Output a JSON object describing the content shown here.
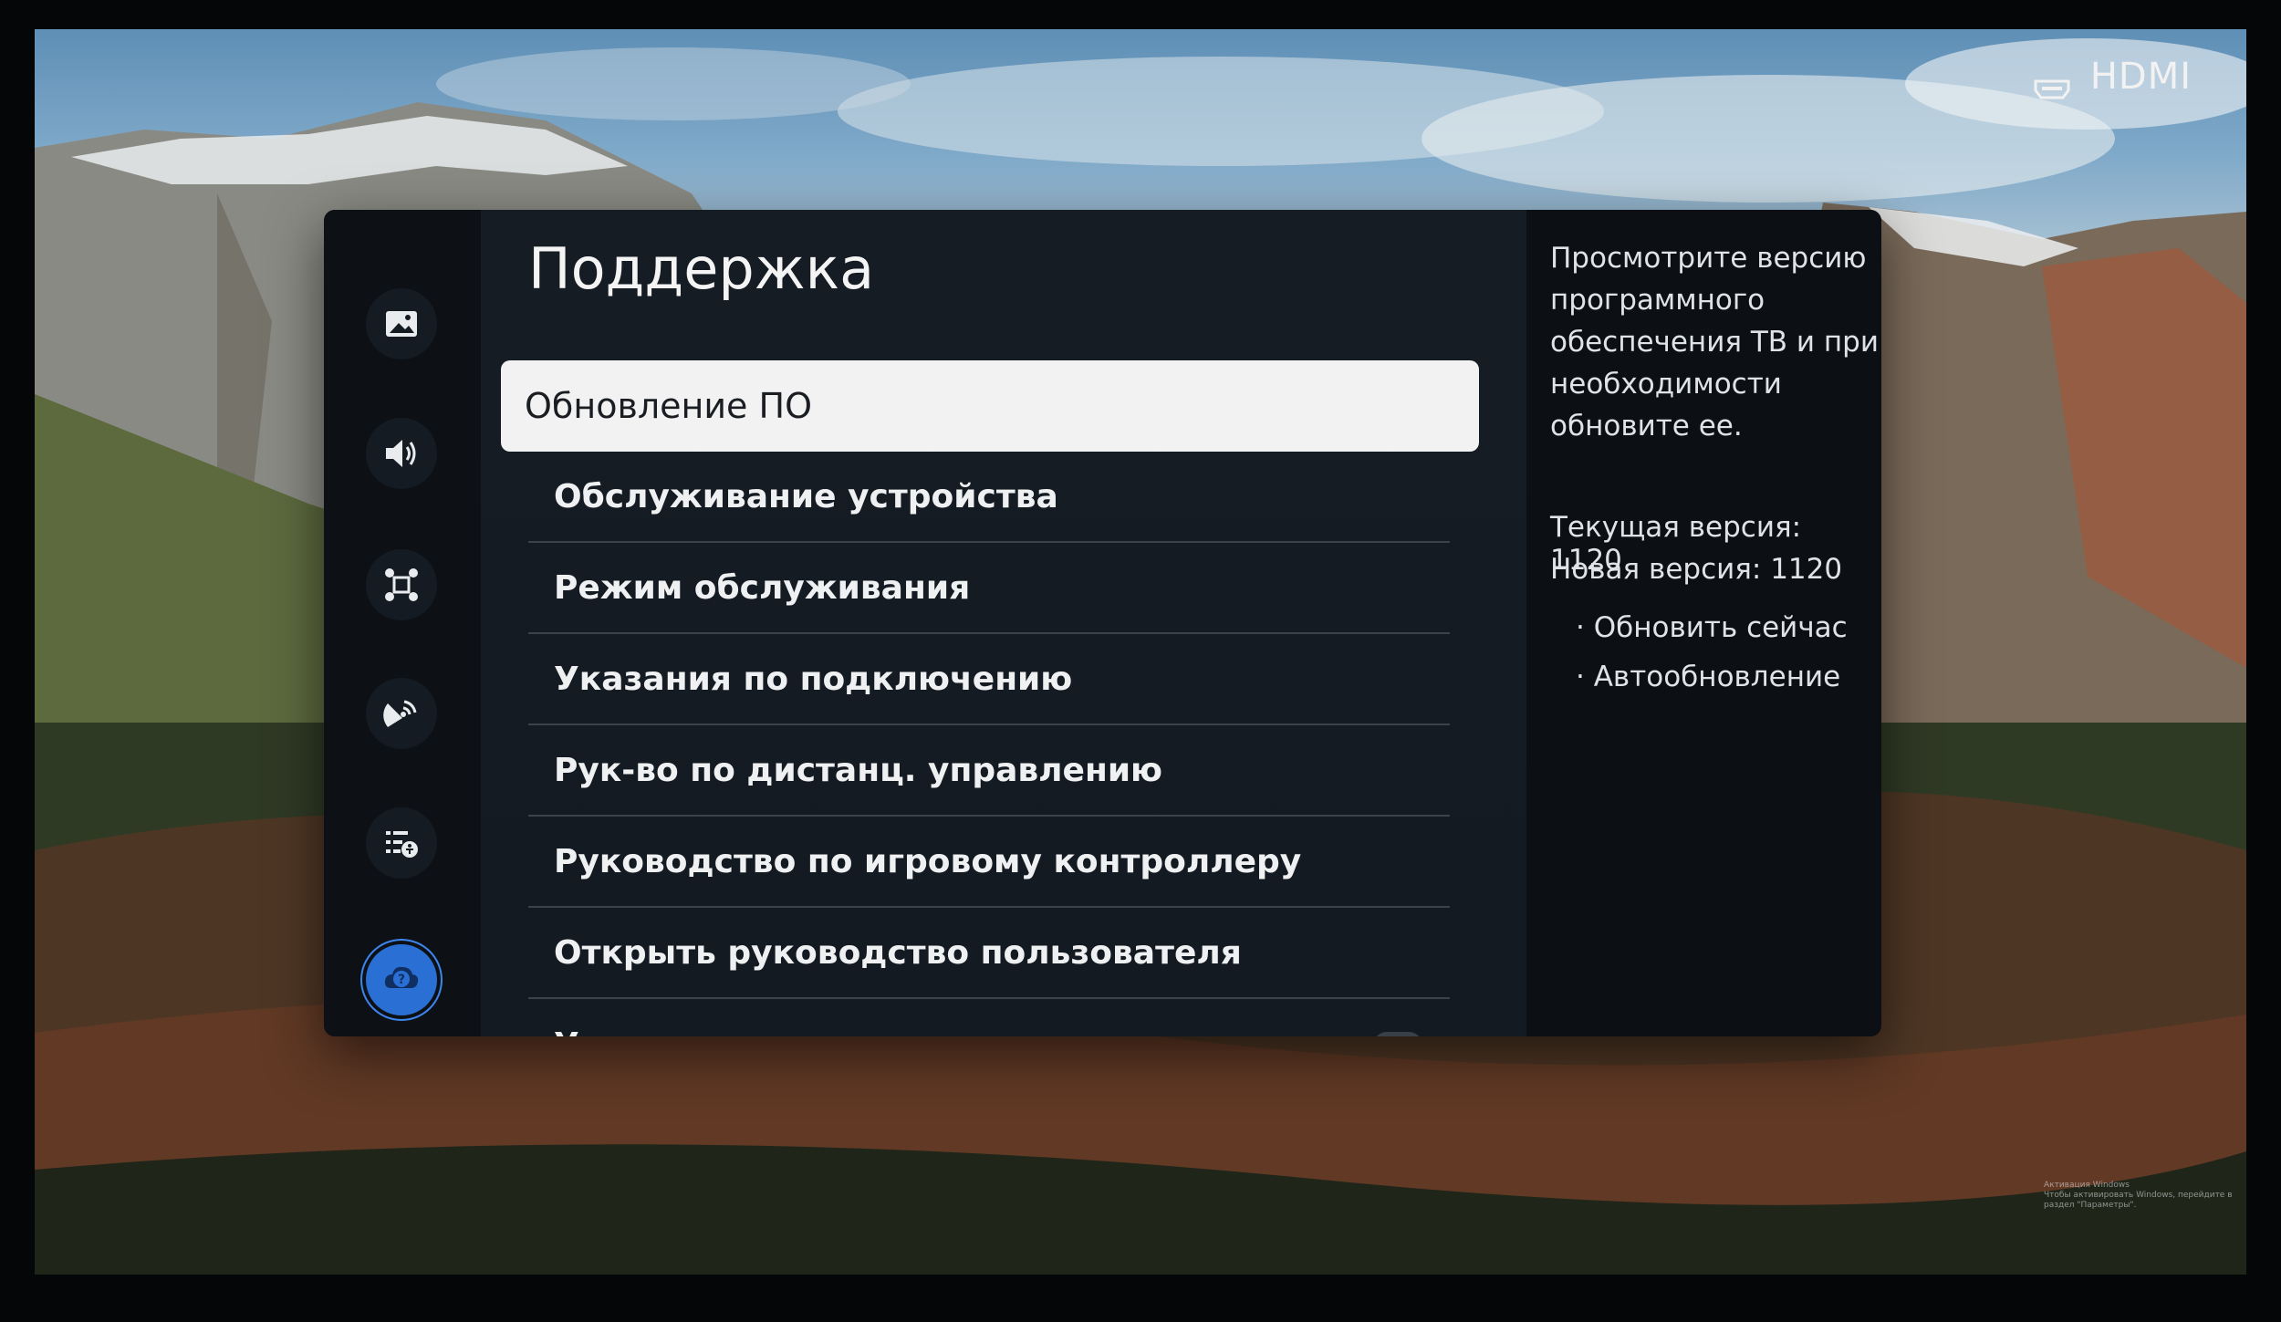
{
  "input_source": {
    "icon": "hdmi-icon",
    "label": "HDMI"
  },
  "sidebar": {
    "items": [
      {
        "icon": "picture-icon"
      },
      {
        "icon": "sound-icon"
      },
      {
        "icon": "connection-icon"
      },
      {
        "icon": "broadcast-icon"
      },
      {
        "icon": "accessibility-icon"
      },
      {
        "icon": "support-icon",
        "active": true
      }
    ]
  },
  "main": {
    "title": "Поддержка",
    "items": [
      {
        "label": "Обновление ПО",
        "focused": true
      },
      {
        "label": "Обслуживание устройства"
      },
      {
        "label": "Режим обслуживания"
      },
      {
        "label": "Указания по подключению"
      },
      {
        "label": "Рук-во по дистанц. управлению"
      },
      {
        "label": "Руководство по игровому контроллеру"
      },
      {
        "label": "Открыть руководство пользователя"
      },
      {
        "label": "Удаленное управление",
        "toggle": "off"
      }
    ]
  },
  "info": {
    "description": "Просмотрите версию программного обеспечения ТВ и при необходимости обновите ее.",
    "current_version": "Текущая версия: 1120",
    "new_version": "Новая версия: 1120",
    "options": [
      "Обновить сейчас",
      "Автообновление"
    ]
  },
  "watermark": {
    "line1": "Активация Windows",
    "line2": "Чтобы активировать Windows, перейдите в раздел \"Параметры\"."
  },
  "colors": {
    "accent": "#2a6fd4",
    "panel": "#12161c",
    "focus_bg": "#f2f2f2"
  }
}
